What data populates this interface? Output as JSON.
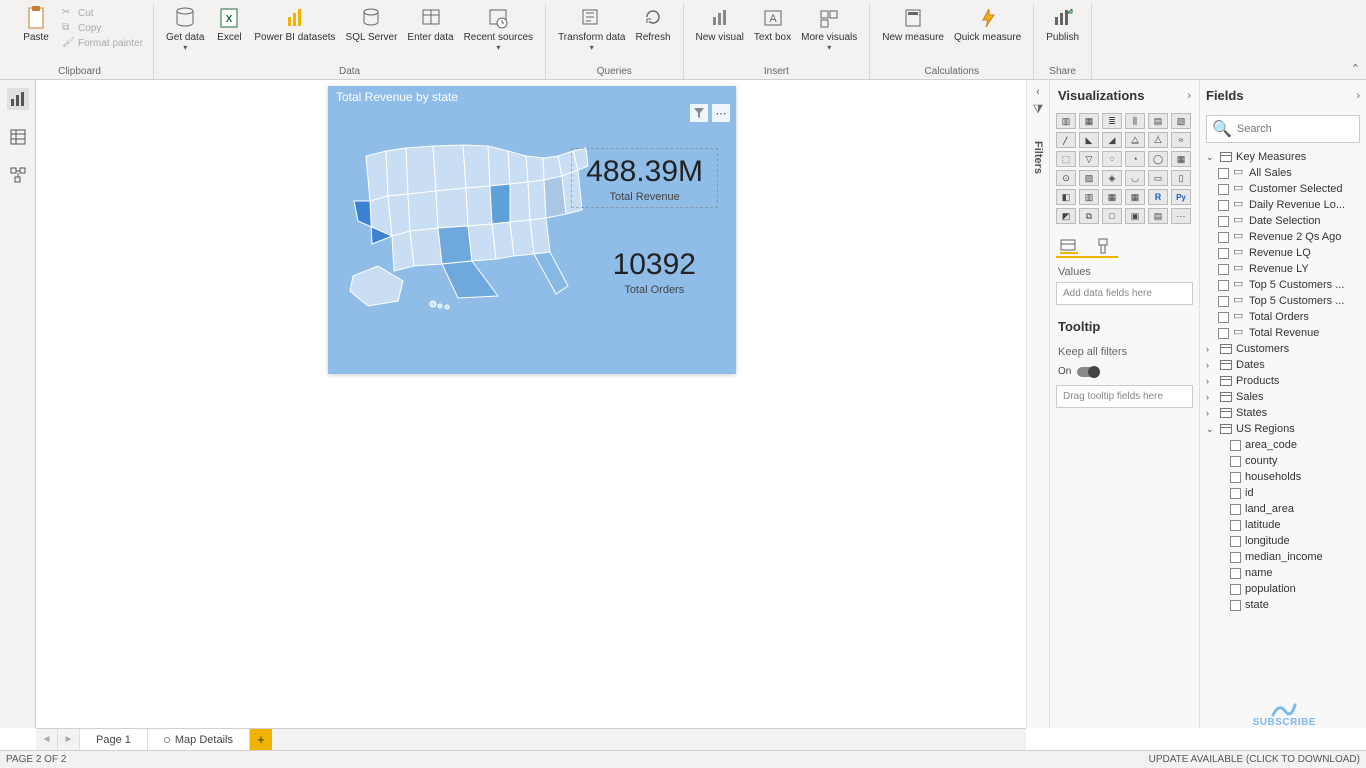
{
  "ribbon": {
    "clipboard": {
      "label": "Clipboard",
      "paste": "Paste",
      "cut": "Cut",
      "copy": "Copy",
      "format_painter": "Format painter"
    },
    "data": {
      "label": "Data",
      "get_data": "Get data",
      "excel": "Excel",
      "pbi_datasets": "Power BI datasets",
      "sql": "SQL Server",
      "enter": "Enter data",
      "recent": "Recent sources"
    },
    "queries": {
      "label": "Queries",
      "transform": "Transform data",
      "refresh": "Refresh"
    },
    "insert": {
      "label": "Insert",
      "new_visual": "New visual",
      "text_box": "Text box",
      "more": "More visuals"
    },
    "calculations": {
      "label": "Calculations",
      "new_measure": "New measure",
      "quick_measure": "Quick measure"
    },
    "share": {
      "label": "Share",
      "publish": "Publish"
    }
  },
  "canvas": {
    "visual_title": "Total Revenue by state",
    "card1_value": "488.39M",
    "card1_label": "Total Revenue",
    "card2_value": "10392",
    "card2_label": "Total Orders"
  },
  "filters_label": "Filters",
  "vis": {
    "title": "Visualizations",
    "values_label": "Values",
    "values_placeholder": "Add data fields here",
    "tooltip_label": "Tooltip",
    "keep_filters": "Keep all filters",
    "toggle_on": "On",
    "tooltip_placeholder": "Drag tooltip fields here"
  },
  "fields": {
    "title": "Fields",
    "search_placeholder": "Search",
    "key_measures": "Key Measures",
    "measures": [
      "All Sales",
      "Customer Selected",
      "Daily Revenue Lo...",
      "Date Selection",
      "Revenue 2 Qs Ago",
      "Revenue LQ",
      "Revenue LY",
      "Top 5 Customers ...",
      "Top 5 Customers ...",
      "Total Orders",
      "Total Revenue"
    ],
    "tables": [
      "Customers",
      "Dates",
      "Products",
      "Sales",
      "States"
    ],
    "us_regions": "US Regions",
    "us_cols": [
      "area_code",
      "county",
      "households",
      "id",
      "land_area",
      "latitude",
      "longitude",
      "median_income",
      "name",
      "population",
      "state"
    ]
  },
  "tabs": {
    "page1": "Page 1",
    "page2": "Map Details"
  },
  "status": {
    "left": "PAGE 2 OF 2",
    "right": "UPDATE AVAILABLE (CLICK TO DOWNLOAD)"
  },
  "stamp": "SUBSCRIBE"
}
